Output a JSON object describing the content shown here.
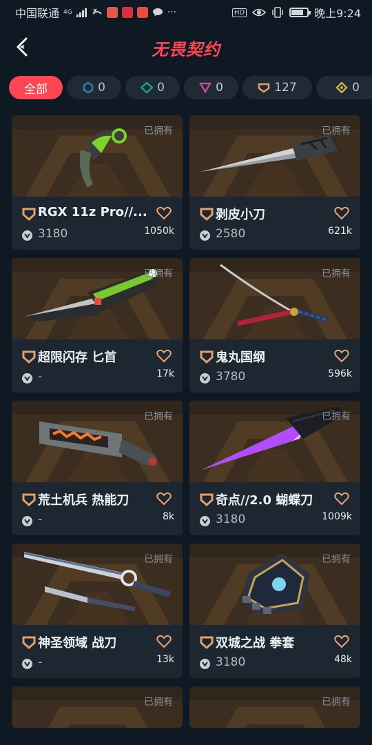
{
  "status_bar": {
    "carrier": "中国联通",
    "network": "4G",
    "time": "晚上9:24",
    "hd": "HD",
    "battery_level": 0.75
  },
  "header": {
    "title": "无畏契约",
    "back_icon": "chevron-left-icon"
  },
  "filters": [
    {
      "label": "全部",
      "active": true
    },
    {
      "count": "0",
      "icon": "tier-select-icon",
      "color": "#2a7fb0"
    },
    {
      "count": "0",
      "icon": "tier-deluxe-icon",
      "color": "#1f9c8a"
    },
    {
      "count": "0",
      "icon": "tier-premium-icon",
      "color": "#c04f9a"
    },
    {
      "count": "127",
      "icon": "tier-exclusive-icon",
      "color": "#e3a06a"
    },
    {
      "count": "0",
      "icon": "tier-ultra-icon",
      "color": "#c8b24a"
    }
  ],
  "owned_label": "已拥有",
  "items": [
    {
      "name": "RGX 11z Pro//...",
      "price": "3180",
      "likes": "1050k",
      "weapon": "karambit-green"
    },
    {
      "name": "剥皮小刀",
      "price": "2580",
      "likes": "621k",
      "weapon": "bayonet-steel"
    },
    {
      "name": "超限闪存 匕首",
      "price": "-",
      "likes": "17k",
      "weapon": "knife-green-black"
    },
    {
      "name": "鬼丸国纲",
      "price": "3780",
      "likes": "596k",
      "weapon": "katana"
    },
    {
      "name": "荒土机兵 热能刀",
      "price": "-",
      "likes": "8k",
      "weapon": "heat-blade"
    },
    {
      "name": "奇点//2.0 蝴蝶刀",
      "price": "3180",
      "likes": "1009k",
      "weapon": "crystal-blade"
    },
    {
      "name": "神圣领域 战刀",
      "price": "-",
      "likes": "13k",
      "weapon": "twin-blade"
    },
    {
      "name": "双城之战 拳套",
      "price": "3180",
      "likes": "48k",
      "weapon": "gauntlet"
    }
  ],
  "colors": {
    "accent": "#ff4655",
    "background": "#0f1923",
    "card": "#1d2731",
    "tier_exclusive": "#e3a06a"
  }
}
